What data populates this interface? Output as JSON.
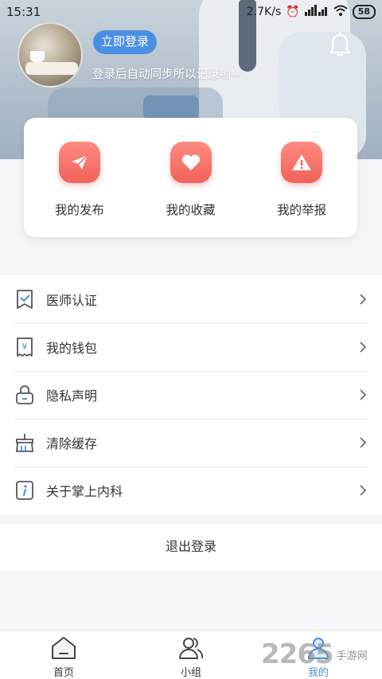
{
  "status_bar": {
    "time": "15:31",
    "speed": "2.7K/s",
    "battery": "58"
  },
  "profile": {
    "login_label": "立即登录",
    "hint": "登录后自动同步所以记录哟~"
  },
  "quick_actions": [
    {
      "label": "我的发布",
      "icon": "paper-plane-icon"
    },
    {
      "label": "我的收藏",
      "icon": "heart-icon"
    },
    {
      "label": "我的举报",
      "icon": "warning-icon"
    }
  ],
  "menu": [
    {
      "label": "医师认证",
      "icon": "certificate-icon"
    },
    {
      "label": "我的钱包",
      "icon": "wallet-icon"
    },
    {
      "label": "隐私声明",
      "icon": "lock-icon"
    },
    {
      "label": "清除缓存",
      "icon": "broom-icon"
    },
    {
      "label": "关于掌上内科",
      "icon": "info-icon"
    }
  ],
  "logout_label": "退出登录",
  "tabs": [
    {
      "label": "首页",
      "icon": "home-icon"
    },
    {
      "label": "小组",
      "icon": "group-icon"
    },
    {
      "label": "我的",
      "icon": "profile-icon",
      "active": true
    }
  ],
  "watermark": {
    "number": "2265",
    "text": "手游网"
  },
  "colors": {
    "accent": "#4a90e2",
    "icon_red": "#f0625a",
    "menu_icon": "#4a90e2"
  }
}
